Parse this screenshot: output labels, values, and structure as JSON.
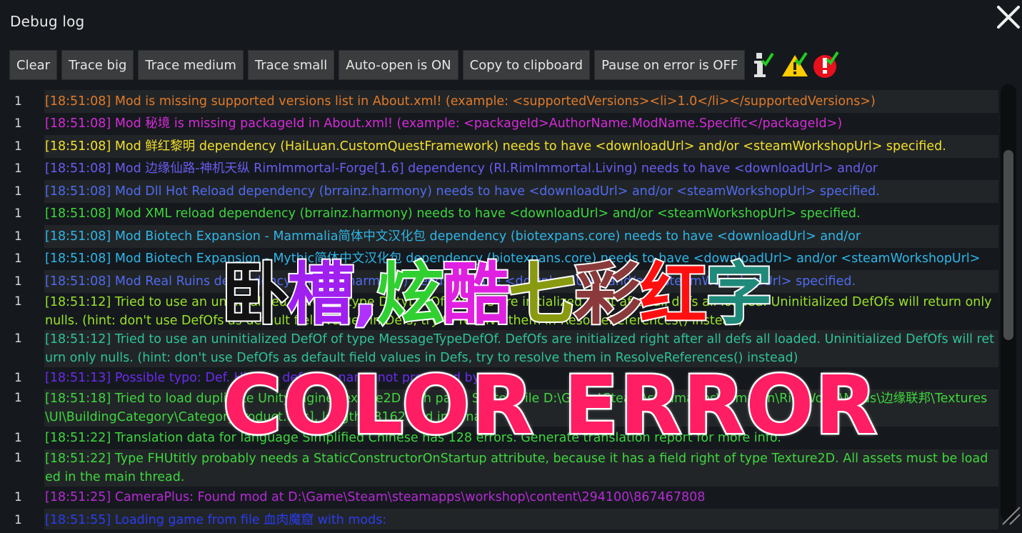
{
  "window": {
    "title": "Debug log"
  },
  "toolbar": {
    "buttons": [
      "Clear",
      "Trace big",
      "Trace medium",
      "Trace small",
      "Auto-open is ON",
      "Copy to clipboard",
      "Pause on error is OFF"
    ],
    "icons": [
      {
        "name": "info-toggle-icon",
        "color": "#e0e0e0",
        "check": "#22cc22"
      },
      {
        "name": "warning-toggle-icon",
        "color": "#ffcc00",
        "check": "#22cc22"
      },
      {
        "name": "error-toggle-icon",
        "color": "#e8101c",
        "check": "#22cc22"
      }
    ]
  },
  "log": {
    "rows": [
      {
        "count": "",
        "text": "",
        "color": "#e07a2a",
        "lines": 0
      },
      {
        "count": "1",
        "text": "[18:51:08] Mod  is missing supported versions list in About.xml! (example: <supportedVersions><li>1.0</li></supportedVersions>)",
        "color": "#e07a2a",
        "lines": 1
      },
      {
        "count": "1",
        "text": "[18:51:08] Mod 秘境 is missing packageId in About.xml! (example: <packageId>AuthorName.ModName.Specific</packageId>)",
        "color": "#d62ad9",
        "lines": 1
      },
      {
        "count": "1",
        "text": "[18:51:08] Mod 鲜红黎明 dependency (HaiLuan.CustomQuestFramework) needs to have <downloadUrl> and/or <steamWorkshopUrl> specified.",
        "color": "#f2e02a",
        "lines": 1
      },
      {
        "count": "1",
        "text": "[18:51:08] Mod 边缘仙路-神机天纵 RimImmortal-Forge[1.6] dependency (RI.RimImmortal.Living) needs to have <downloadUrl> and/or",
        "color": "#6a5cf0",
        "lines": 1
      },
      {
        "count": "1",
        "text": "[18:51:08] Mod Dll Hot Reload dependency (brrainz.harmony) needs to have <downloadUrl> and/or <steamWorkshopUrl> specified.",
        "color": "#4f6af0",
        "lines": 1
      },
      {
        "count": "1",
        "text": "[18:51:08] Mod XML reload dependency (brrainz.harmony) needs to have <downloadUrl> and/or <steamWorkshopUrl> specified.",
        "color": "#3ed63e",
        "lines": 1
      },
      {
        "count": "1",
        "text": "[18:51:08] Mod Biotech Expansion - Mammalia简体中文汉化包 dependency (biotexpans.core) needs to have <downloadUrl> and/or",
        "color": "#2eb6e8",
        "lines": 1
      },
      {
        "count": "1",
        "text": "[18:51:08] Mod Biotech Expansion - Mythic简体中文汉化包 dependency (biotexpans.core) needs to have <downloadUrl> and/or <steamWorkshopUrl>",
        "color": "#2eb6e8",
        "lines": 1
      },
      {
        "count": "1",
        "text": "[18:51:08] Mod Real Ruins dependency (brrainz.harmony) needs to have <downloadUrl> and/or <steamWorkshopUrl> specified.",
        "color": "#4f6af0",
        "lines": 1
      },
      {
        "count": "1",
        "text": "[18:51:12] Tried to use an uninitialized DefOf of type DutyDefOf. DefOfs are initialized right after all defs all loaded. Uninitialized DefOfs will return only nulls. (hint: don't use DefOfs as default field values in Defs, try to resolve them in ResolveReferences() instead)",
        "color": "#9ae02a",
        "lines": 2
      },
      {
        "count": "1",
        "text": "[18:51:12] Tried to use an uninitialized DefOf of type MessageTypeDefOf. DefOfs are initialized right after all defs all loaded. Uninitialized DefOfs will return only nulls. (hint: don't use DefOfs as default field values in Defs, try to resolve them in ResolveReferences() instead)",
        "color": "#2ec29a",
        "lines": 2
      },
      {
        "count": "1",
        "text": "[18:51:13] Possible typo: Def. Hidden def type name not preceded by",
        "color": "#6a2af0",
        "lines": 1
      },
      {
        "count": "1",
        "text": "[18:51:18] Tried to load duplicate UnityEngine.Texture2D with path: SystemFile D:\\Game\\Steam\\steamapps\\common\\RimWorld\\Mods\\边缘联邦\\Textures\\UI\\BuildingCategory\\CategoryProduct.dds], length 98162 and internal",
        "color": "#3ed63e",
        "lines": 2
      },
      {
        "count": "1",
        "text": "[18:51:22] Translation data for language Simplified Chinese has 128 errors. Generate translation report for more info.",
        "color": "#3ed63e",
        "lines": 1
      },
      {
        "count": "1",
        "text": "[18:51:22] Type FHUtitly probably needs a StaticConstructorOnStartup attribute, because it has a field right of type Texture2D. All assets must be loaded in the main thread.",
        "color": "#3ed63e",
        "lines": 2
      },
      {
        "count": "1",
        "text": "[18:51:25] CameraPlus: Found mod at D:\\Game\\Steam\\steamapps\\workshop\\content\\294100\\867467808",
        "color": "#b62ad6",
        "lines": 1
      },
      {
        "count": "1",
        "text": "[18:51:55] Loading game from file 血肉魔窟 with mods:",
        "color": "#2a3cf0",
        "lines": 1
      }
    ]
  },
  "overlay": {
    "chars": [
      {
        "ch": "卧",
        "color": "#111111"
      },
      {
        "ch": "槽",
        "color": "#a020f0"
      },
      {
        "ch": ",",
        "color": "#b030ff"
      },
      {
        "ch": "炫",
        "color": "#30d030"
      },
      {
        "ch": "酷",
        "color": "#e020e0"
      },
      {
        "ch": "七",
        "color": "#8a9a10"
      },
      {
        "ch": "彩",
        "color": "#8a3a3a"
      },
      {
        "ch": "红",
        "color": "#ff1010"
      },
      {
        "ch": "字",
        "color": "#208a7a"
      }
    ],
    "banner": "COLOR ERROR"
  }
}
